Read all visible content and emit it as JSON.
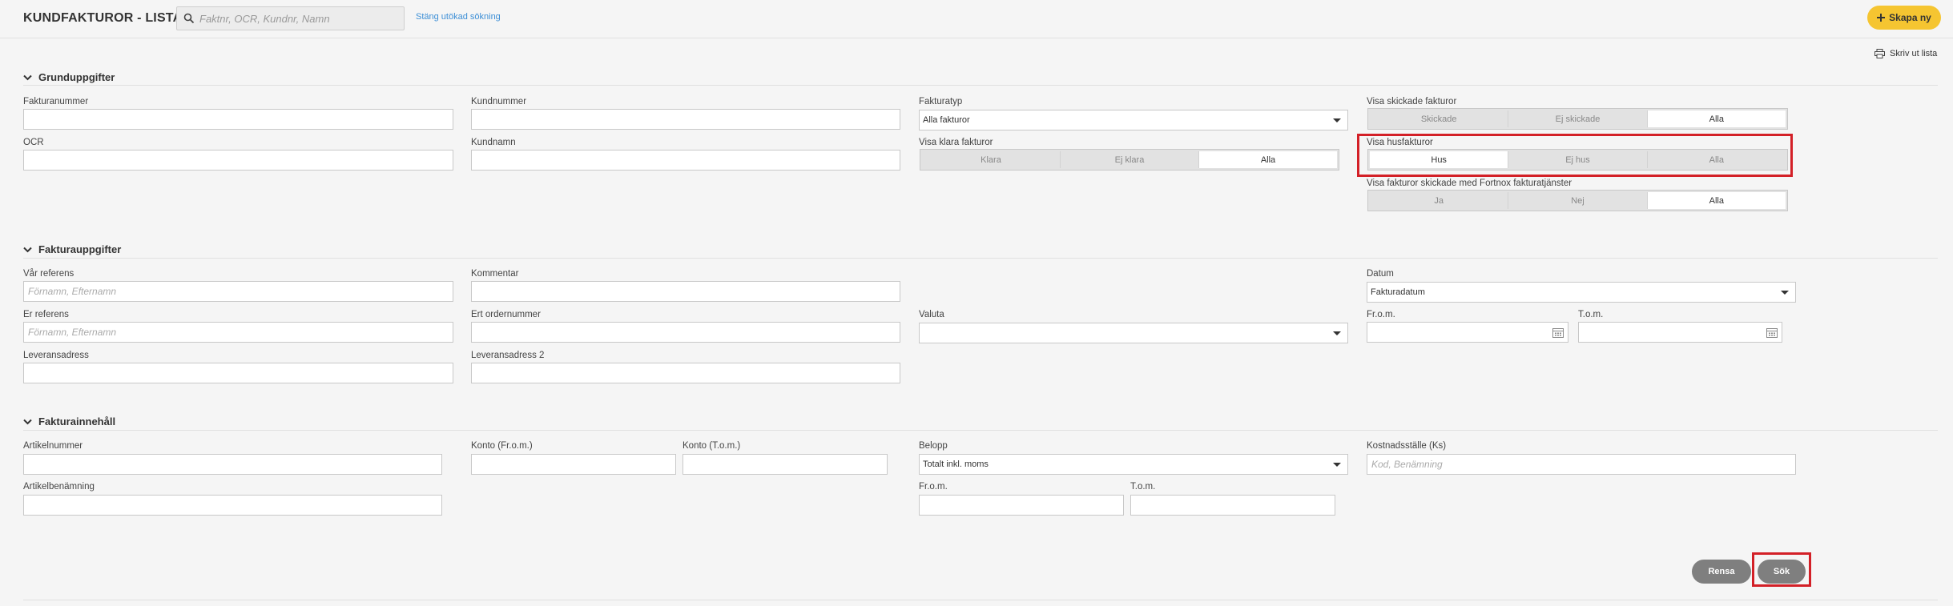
{
  "header": {
    "title": "KUNDFAKTUROR - LISTA",
    "search_placeholder": "Faktnr, OCR, Kundnr, Namn",
    "close_advanced_search": "Stäng utökad sökning",
    "create_new": "Skapa ny",
    "print_list": "Skriv ut lista"
  },
  "basic": {
    "heading": "Grunduppgifter",
    "invoice_number_label": "Fakturanummer",
    "customer_number_label": "Kundnummer",
    "invoice_type_label": "Fakturatyp",
    "invoice_type_value": "Alla fakturor",
    "show_sent_label": "Visa skickade fakturor",
    "show_sent_options": [
      "Skickade",
      "Ej skickade",
      "Alla"
    ],
    "ocr_label": "OCR",
    "customer_name_label": "Kundnamn",
    "show_ready_label": "Visa klara fakturor",
    "show_ready_options": [
      "Klara",
      "Ej klara",
      "Alla"
    ],
    "show_house_label": "Visa husfakturor",
    "show_house_options": [
      "Hus",
      "Ej hus",
      "Alla"
    ],
    "show_fortnox_label": "Visa fakturor skickade med Fortnox fakturatjänster",
    "show_fortnox_options": [
      "Ja",
      "Nej",
      "Alla"
    ]
  },
  "invoice": {
    "heading": "Fakturauppgifter",
    "our_ref_label": "Vår referens",
    "our_ref_placeholder": "Förnamn, Efternamn",
    "comment_label": "Kommentar",
    "date_label": "Datum",
    "date_value": "Fakturadatum",
    "your_ref_label": "Er referens",
    "your_ref_placeholder": "Förnamn, Efternamn",
    "order_number_label": "Ert ordernummer",
    "currency_label": "Valuta",
    "currency_value": "",
    "from_label": "Fr.o.m.",
    "to_label": "T.o.m.",
    "delivery_address_label": "Leveransadress",
    "delivery_address2_label": "Leveransadress 2"
  },
  "content": {
    "heading": "Fakturainnehåll",
    "article_number_label": "Artikelnummer",
    "account_from_label": "Konto (Fr.o.m.)",
    "account_to_label": "Konto (T.o.m.)",
    "amount_label": "Belopp",
    "amount_value": "Totalt inkl. moms",
    "cost_center_label": "Kostnadsställe (Ks)",
    "cost_center_placeholder": "Kod, Benämning",
    "article_name_label": "Artikelbenämning",
    "amount_from_label": "Fr.o.m.",
    "amount_to_label": "T.o.m."
  },
  "actions": {
    "clear": "Rensa",
    "search": "Sök"
  },
  "colors": {
    "accent": "#f5c531",
    "highlight": "#d32027",
    "link": "#3d8fd6"
  }
}
